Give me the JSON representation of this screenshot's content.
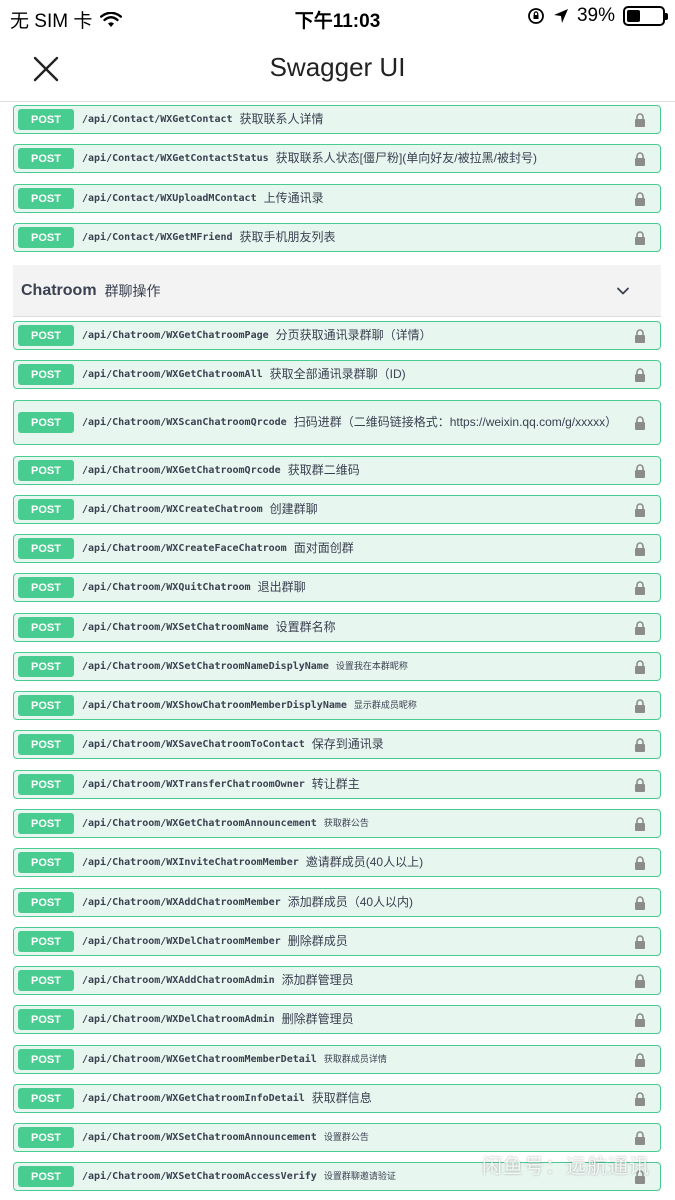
{
  "status_bar": {
    "carrier": "无 SIM 卡",
    "time": "下午11:03",
    "battery_percent": "39%",
    "battery_level": 0.39
  },
  "nav": {
    "title": "Swagger UI"
  },
  "section": {
    "name": "Chatroom",
    "description": "群聊操作"
  },
  "operations": [
    {
      "method": "POST",
      "path": "/api/Contact/WXGetContact",
      "desc": "获取联系人详情"
    },
    {
      "method": "POST",
      "path": "/api/Contact/WXGetContactStatus",
      "desc": "获取联系人状态[僵尸粉](单向好友/被拉黑/被封号)"
    },
    {
      "method": "POST",
      "path": "/api/Contact/WXUploadMContact",
      "desc": "上传通讯录"
    },
    {
      "method": "POST",
      "path": "/api/Contact/WXGetMFriend",
      "desc": "获取手机朋友列表"
    },
    {
      "method": "POST",
      "path": "/api/Chatroom/WXGetChatroomPage",
      "desc": "分页获取通讯录群聊（详情）"
    },
    {
      "method": "POST",
      "path": "/api/Chatroom/WXGetChatroomAll",
      "desc": "获取全部通讯录群聊（ID)"
    },
    {
      "method": "POST",
      "path": "/api/Chatroom/WXScanChatroomQrcode",
      "desc": "扫码进群（二维码链接格式：https://weixin.qq.com/g/xxxxx）"
    },
    {
      "method": "POST",
      "path": "/api/Chatroom/WXGetChatroomQrcode",
      "desc": "获取群二维码"
    },
    {
      "method": "POST",
      "path": "/api/Chatroom/WXCreateChatroom",
      "desc": "创建群聊"
    },
    {
      "method": "POST",
      "path": "/api/Chatroom/WXCreateFaceChatroom",
      "desc": "面对面创群"
    },
    {
      "method": "POST",
      "path": "/api/Chatroom/WXQuitChatroom",
      "desc": "退出群聊"
    },
    {
      "method": "POST",
      "path": "/api/Chatroom/WXSetChatroomName",
      "desc": "设置群名称"
    },
    {
      "method": "POST",
      "path": "/api/Chatroom/WXSetChatroomNameDisplyName",
      "desc": "设置我在本群昵称"
    },
    {
      "method": "POST",
      "path": "/api/Chatroom/WXShowChatroomMemberDisplyName",
      "desc": "显示群成员昵称"
    },
    {
      "method": "POST",
      "path": "/api/Chatroom/WXSaveChatroomToContact",
      "desc": "保存到通讯录"
    },
    {
      "method": "POST",
      "path": "/api/Chatroom/WXTransferChatroomOwner",
      "desc": "转让群主"
    },
    {
      "method": "POST",
      "path": "/api/Chatroom/WXGetChatroomAnnouncement",
      "desc": "获取群公告"
    },
    {
      "method": "POST",
      "path": "/api/Chatroom/WXInviteChatroomMember",
      "desc": "邀请群成员(40人以上)"
    },
    {
      "method": "POST",
      "path": "/api/Chatroom/WXAddChatroomMember",
      "desc": "添加群成员（40人以内)"
    },
    {
      "method": "POST",
      "path": "/api/Chatroom/WXDelChatroomMember",
      "desc": "删除群成员"
    },
    {
      "method": "POST",
      "path": "/api/Chatroom/WXAddChatroomAdmin",
      "desc": "添加群管理员"
    },
    {
      "method": "POST",
      "path": "/api/Chatroom/WXDelChatroomAdmin",
      "desc": "删除群管理员"
    },
    {
      "method": "POST",
      "path": "/api/Chatroom/WXGetChatroomMemberDetail",
      "desc": "获取群成员详情"
    },
    {
      "method": "POST",
      "path": "/api/Chatroom/WXGetChatroomInfoDetail",
      "desc": "获取群信息"
    },
    {
      "method": "POST",
      "path": "/api/Chatroom/WXSetChatroomAnnouncement",
      "desc": "设置群公告"
    },
    {
      "method": "POST",
      "path": "/api/Chatroom/WXSetChatroomAccessVerify",
      "desc": "设置群聊邀请验证"
    }
  ],
  "watermark": "闲鱼号：远航通讯",
  "colors": {
    "post_green": "#49cc90",
    "post_bg": "#e8f6f0",
    "text": "#3b4151"
  }
}
